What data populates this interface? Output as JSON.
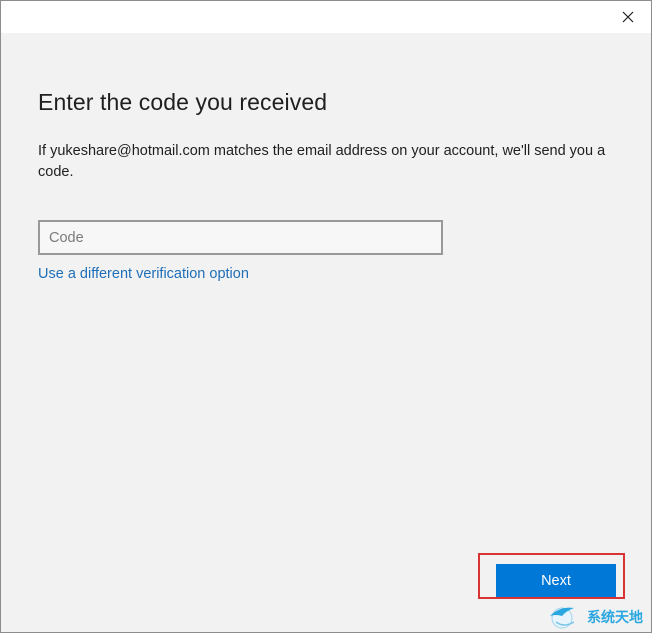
{
  "window": {
    "close_icon": "close-icon"
  },
  "main": {
    "heading": "Enter the code you received",
    "description": "If yukeshare@hotmail.com matches the email address on your account, we'll send you a code.",
    "code_input": {
      "value": "",
      "placeholder": "Code"
    },
    "alt_verification_link": "Use a different verification option"
  },
  "footer": {
    "next_label": "Next",
    "highlight_color": "#d93434"
  },
  "watermark": {
    "text": "系统天地",
    "logo_icon": "globe-bird-icon"
  },
  "colors": {
    "accent": "#0078d7",
    "link": "#1f6fb8",
    "background": "#f2f2f2"
  }
}
